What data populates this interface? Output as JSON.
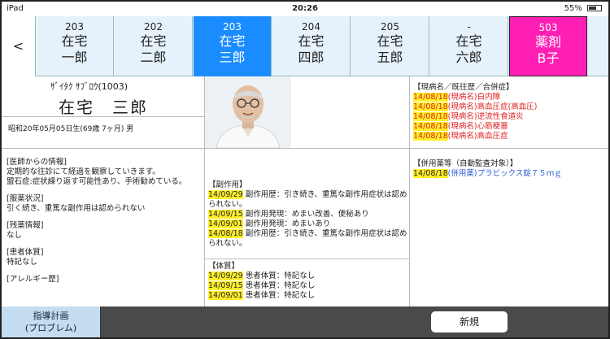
{
  "status": {
    "device": "iPad",
    "time": "20:26",
    "battery": "55%"
  },
  "tabs": {
    "back": "<",
    "items": [
      {
        "num": "203",
        "line1": "在宅",
        "line2": "一郎"
      },
      {
        "num": "202",
        "line1": "在宅",
        "line2": "二郎"
      },
      {
        "num": "203",
        "line1": "在宅",
        "line2": "三郎"
      },
      {
        "num": "204",
        "line1": "在宅",
        "line2": "四郎"
      },
      {
        "num": "205",
        "line1": "在宅",
        "line2": "五郎"
      },
      {
        "num": "-",
        "line1": "在宅",
        "line2": "六郎"
      },
      {
        "num": "503",
        "line1": "薬剤",
        "line2": "B子"
      }
    ]
  },
  "patient": {
    "kana": "ｻﾞｲﾀｸ ｻﾌﾞﾛｳ(1003)",
    "name": "在宅　三郎",
    "dob": "昭和20年05月05日生(69歳 7ヶ月) 男"
  },
  "info": {
    "doctor_title": "[医師からの情報]",
    "doctor_body1": "定期的な往診にて経過を観察していきます。",
    "doctor_body2": "盟石症:症状繰り返す可能性あり、手術勧めている。",
    "med_status_title": "[服薬状況]",
    "med_status_body": "引く続き、重篤な副作用は認められない",
    "leftover_title": "[残薬情報]",
    "leftover_body": "なし",
    "constitution_title": "[患者体質]",
    "constitution_body": "特記なし",
    "allergy_title": "[アレルギー歴]"
  },
  "side_effects": {
    "title": "【副作用】",
    "entries": [
      {
        "date": "14/09/29",
        "text": "副作用歴：引き続き、重篤な副作用症状は認められない。"
      },
      {
        "date": "14/09/15",
        "text": "副作用発現：めまい改善、便秘あり"
      },
      {
        "date": "14/09/01",
        "text": "副作用発現：めまいあり"
      },
      {
        "date": "14/08/18",
        "text": "副作用歴：引き続き、重篤な副作用症状は認められない。"
      }
    ]
  },
  "constitution": {
    "title": "【体質】",
    "entries": [
      {
        "date": "14/09/29",
        "text": "患者体質：特記なし"
      },
      {
        "date": "14/09/15",
        "text": "患者体質：特記なし"
      },
      {
        "date": "14/09/01",
        "text": "患者体質：特記なし"
      }
    ]
  },
  "diseases": {
    "title": "【現病名／既往歴／合併症】",
    "entries": [
      {
        "date": "14/08/18",
        "text": "(現病名)白内障"
      },
      {
        "date": "14/08/18",
        "text": "(現病名)高血圧症(高血圧)"
      },
      {
        "date": "14/08/18",
        "text": "(現病名)逆流性食道炎"
      },
      {
        "date": "14/08/18",
        "text": "(現病名)心筋梗塞"
      },
      {
        "date": "14/08/18",
        "text": "(現病名)高血圧症"
      }
    ]
  },
  "concomitant": {
    "title": "【併用薬等（自動監査対象）】",
    "entries": [
      {
        "date": "14/08/18",
        "text": "(併用薬)プラビックス錠７５ｍｇ"
      }
    ]
  },
  "bottom": {
    "plan_line1": "指導計画",
    "plan_line2": "(プロブレム)",
    "new_label": "新規"
  },
  "colors": {
    "active_tab": "#1a8cff",
    "special_tab": "#ff1fb4",
    "tab_bg": "#e6f2fb",
    "highlight": "#ffef2a",
    "disease_text": "#e02020",
    "concomitant_text": "#2a5bd7"
  }
}
